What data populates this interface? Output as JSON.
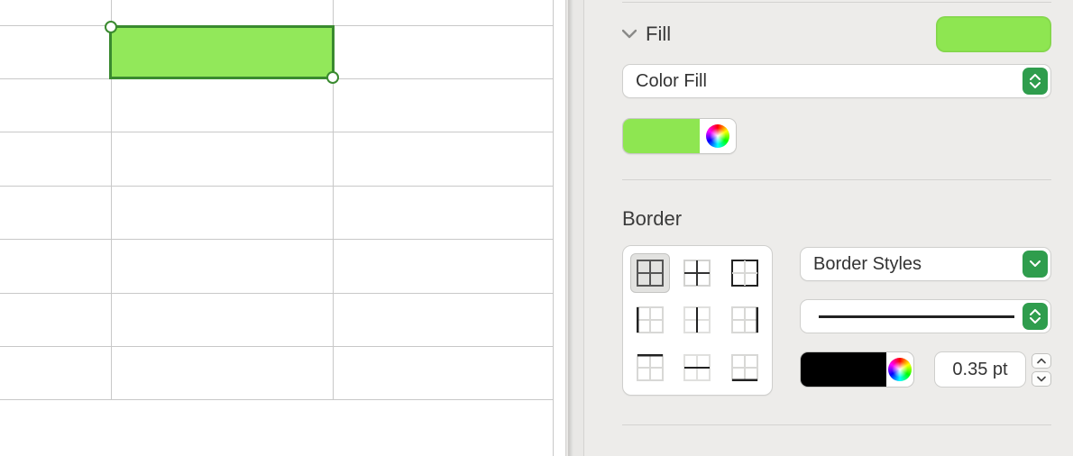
{
  "fill": {
    "section_label": "Fill",
    "type_label": "Color Fill",
    "swatch_color": "#8ee651"
  },
  "border": {
    "section_label": "Border",
    "styles_label": "Border Styles",
    "line_weight": "0.35 pt",
    "color": "#000000"
  }
}
